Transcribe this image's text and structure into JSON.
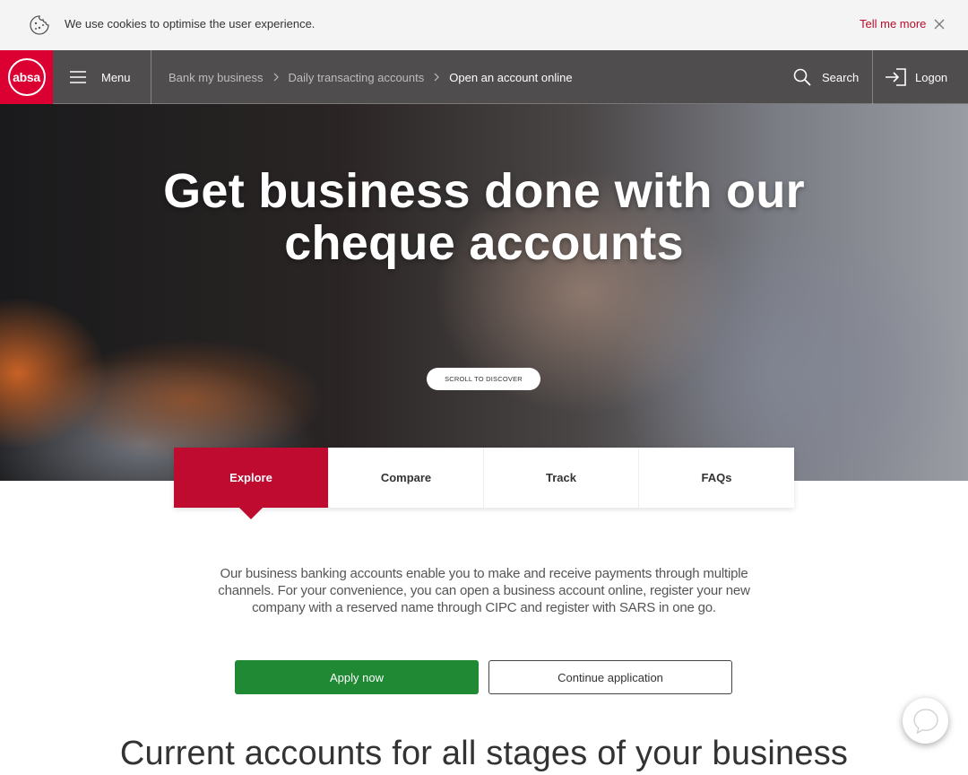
{
  "cookie_bar": {
    "message": "We use cookies to optimise the user experience.",
    "more_link": "Tell me more",
    "icons": {
      "cookie": "cookie-icon",
      "close": "close-icon"
    }
  },
  "nav": {
    "logo_text": "absa",
    "menu_label": "Menu",
    "breadcrumbs": [
      "Bank my business",
      "Daily transacting accounts",
      "Open an account online"
    ],
    "search_label": "Search",
    "logon_label": "Logon",
    "icons": {
      "menu": "hamburger-icon",
      "search": "search-icon",
      "logon": "logon-icon",
      "separator": "chevron-right-icon"
    }
  },
  "hero": {
    "title_line1": "Get business done with our",
    "title_line2": "cheque accounts",
    "scroll_label": "SCROLL TO DISCOVER"
  },
  "tabs": [
    {
      "label": "Explore",
      "active": true
    },
    {
      "label": "Compare",
      "active": false
    },
    {
      "label": "Track",
      "active": false
    },
    {
      "label": "FAQs",
      "active": false
    }
  ],
  "intro": {
    "line1": "Our business banking accounts enable you to make and receive payments through multiple",
    "line2": "channels. For your convenience, you can open a business account online, register your new",
    "line3": "company with a reserved name through CIPC and register with SARS in one go."
  },
  "actions": {
    "apply_label": "Apply now",
    "continue_label": "Continue application"
  },
  "section": {
    "title": "Current accounts for all stages of your business"
  },
  "chat": {
    "icon": "chat-bubble-icon"
  },
  "colors": {
    "brand_red": "#dc0032",
    "tab_active": "#be0b2f",
    "apply_green": "#1f8a33",
    "link_red": "#b70e2c"
  }
}
